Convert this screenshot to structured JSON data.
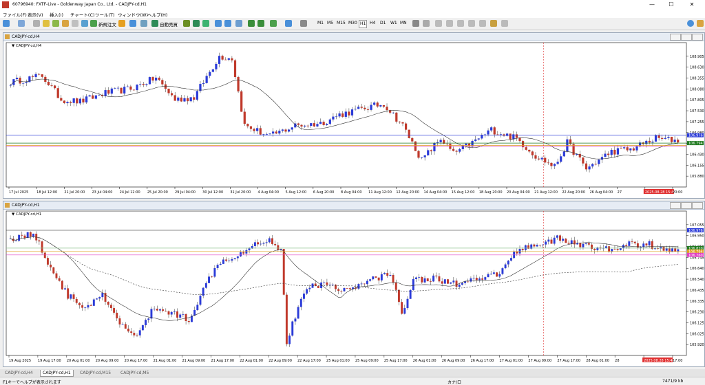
{
  "window": {
    "title": "60796940: FXTF-Live - Goldenway Japan Co., Ltd. - CADJPY-cd,H1"
  },
  "menu": [
    "ファイル(F)",
    "表示(V)",
    "挿入(I)",
    "チャート(C)",
    "ツール(T)",
    "ウィンドウ(W)",
    "ヘルプ(H)"
  ],
  "toolbar": {
    "new_order": "新規注文",
    "auto_trade": "自動売買",
    "timeframes": [
      "M1",
      "M5",
      "M15",
      "M30",
      "H1",
      "H4",
      "D1",
      "W1",
      "MN"
    ],
    "active_timeframe": "H1"
  },
  "charts": [
    {
      "caption": "CADJPY-cd,H4",
      "label": "CADJPY-cd,H4",
      "price_ticks": [
        "108.905",
        "108.630",
        "108.355",
        "108.080",
        "107.805",
        "107.530",
        "107.255",
        "106.980",
        "106.705",
        "106.430",
        "106.155",
        "105.880"
      ],
      "price_range": [
        105.78,
        109.05
      ],
      "hlines": [
        {
          "price": 106.976,
          "label": "106.976",
          "color": "#2b3bd8",
          "label_bg": "#2b3bd8"
        },
        {
          "price": 106.794,
          "label": "106.794",
          "color": "#1f7a1f",
          "label_bg": "#1f7a1f"
        },
        {
          "price": 106.74,
          "label": "",
          "color": "#e0a020",
          "label_bg": ""
        },
        {
          "price": 106.72,
          "label": "",
          "color": "#e040c0",
          "label_bg": ""
        }
      ],
      "date_ticks": [
        "17 Jul 2025",
        "18 Jul 12:00",
        "21 Jul 20:00",
        "23 Jul 04:00",
        "24 Jul 12:00",
        "25 Jul 20:00",
        "29 Jul 04:00",
        "30 Jul 12:00",
        "31 Jul 20:00",
        "4 Aug 04:00",
        "5 Aug 12:00",
        "6 Aug 20:00",
        "8 Aug 04:00",
        "11 Aug 12:00",
        "12 Aug 20:00",
        "14 Aug 04:00",
        "15 Aug 12:00",
        "18 Aug 20:00",
        "20 Aug 04:00",
        "21 Aug 12:00",
        "22 Aug 20:00",
        "26 Aug 04:00",
        "27",
        "2025.08.28 15:45",
        "20:00"
      ],
      "cursor_label": "2025.08.28 15:45",
      "anchors": [
        [
          0,
          108.2
        ],
        [
          10,
          108.35
        ],
        [
          16,
          107.8
        ],
        [
          22,
          107.75
        ],
        [
          30,
          107.95
        ],
        [
          38,
          108.05
        ],
        [
          46,
          108.3
        ],
        [
          52,
          107.8
        ],
        [
          58,
          107.85
        ],
        [
          66,
          108.8
        ],
        [
          70,
          108.75
        ],
        [
          74,
          107.2
        ],
        [
          82,
          106.95
        ],
        [
          90,
          107.2
        ],
        [
          98,
          107.25
        ],
        [
          104,
          107.45
        ],
        [
          112,
          107.6
        ],
        [
          118,
          107.7
        ],
        [
          124,
          107.2
        ],
        [
          130,
          106.4
        ],
        [
          136,
          106.9
        ],
        [
          140,
          106.55
        ],
        [
          146,
          106.8
        ],
        [
          152,
          107.1
        ],
        [
          160,
          106.9
        ],
        [
          166,
          106.5
        ],
        [
          172,
          106.25
        ],
        [
          176,
          106.8
        ],
        [
          182,
          106.2
        ],
        [
          190,
          106.6
        ],
        [
          196,
          106.65
        ],
        [
          204,
          106.9
        ],
        [
          212,
          106.85
        ]
      ],
      "candles": 212,
      "ma": {
        "color": "#333333",
        "dash": "",
        "period": 20
      }
    },
    {
      "caption": "CADJPY-cd,H1",
      "label": "CADJPY-cd,H1",
      "price_ticks": [
        "107.055",
        "106.950",
        "106.850",
        "106.745",
        "106.640",
        "106.540",
        "106.435",
        "106.335",
        "106.230",
        "106.125",
        "106.025",
        "105.920"
      ],
      "price_range": [
        105.88,
        107.12
      ],
      "hlines": [
        {
          "price": 106.976,
          "label": "106.976",
          "color": "#333333",
          "label_bg": "#2b3bd8"
        },
        {
          "price": 106.82,
          "label": "106.820",
          "color": "#8ac08a",
          "label_bg": "#1f7a1f"
        },
        {
          "price": 106.79,
          "label": "106.794",
          "color": "#e0a020",
          "label_bg": "#e0a020"
        },
        {
          "price": 106.76,
          "label": "106.760",
          "color": "#e040c0",
          "label_bg": "#e040c0"
        }
      ],
      "date_ticks": [
        "19 Aug 2025",
        "19 Aug 17:00",
        "20 Aug 01:00",
        "20 Aug 09:00",
        "20 Aug 17:00",
        "21 Aug 01:00",
        "21 Aug 09:00",
        "21 Aug 17:00",
        "22 Aug 01:00",
        "22 Aug 09:00",
        "22 Aug 17:00",
        "25 Aug 01:00",
        "25 Aug 09:00",
        "25 Aug 17:00",
        "26 Aug 01:00",
        "26 Aug 09:00",
        "26 Aug 17:00",
        "27 Aug 01:00",
        "27 Aug 09:00",
        "27 Aug 17:00",
        "28 Aug 01:00",
        "28",
        "2025.08.28 15:45",
        "17:00"
      ],
      "cursor_label": "2025.08.28 15:45",
      "anchors": [
        [
          0,
          106.9
        ],
        [
          8,
          106.95
        ],
        [
          14,
          106.65
        ],
        [
          20,
          106.4
        ],
        [
          26,
          106.3
        ],
        [
          32,
          106.4
        ],
        [
          38,
          106.15
        ],
        [
          44,
          106.05
        ],
        [
          50,
          106.3
        ],
        [
          56,
          106.25
        ],
        [
          62,
          106.2
        ],
        [
          68,
          106.5
        ],
        [
          72,
          106.7
        ],
        [
          78,
          106.75
        ],
        [
          84,
          106.85
        ],
        [
          90,
          106.9
        ],
        [
          94,
          106.8
        ],
        [
          96,
          106.0
        ],
        [
          100,
          106.3
        ],
        [
          104,
          106.5
        ],
        [
          110,
          106.5
        ],
        [
          118,
          106.45
        ],
        [
          126,
          106.55
        ],
        [
          132,
          106.6
        ],
        [
          136,
          106.25
        ],
        [
          140,
          106.55
        ],
        [
          148,
          106.55
        ],
        [
          156,
          106.5
        ],
        [
          164,
          106.55
        ],
        [
          170,
          106.6
        ],
        [
          176,
          106.8
        ],
        [
          182,
          106.85
        ],
        [
          190,
          106.9
        ],
        [
          198,
          106.85
        ],
        [
          206,
          106.8
        ],
        [
          214,
          106.85
        ],
        [
          222,
          106.85
        ],
        [
          228,
          106.8
        ],
        [
          233,
          106.8
        ]
      ],
      "candles": 233,
      "ma": {
        "color": "#333333",
        "dash": "",
        "period": 20
      },
      "ma2": {
        "color": "#333333",
        "dash": "2,2",
        "period": 120
      }
    }
  ],
  "tabs": [
    "CADJPY-cd,H4",
    "CADJPY-cd,H1",
    "CADJPY-cd,M15",
    "CADJPY-cd,M5"
  ],
  "active_tab": 1,
  "status": {
    "help": "F1キーでヘルプが表示されます",
    "mode": "カナ/ロ",
    "traffic": "7471/9 kb"
  }
}
